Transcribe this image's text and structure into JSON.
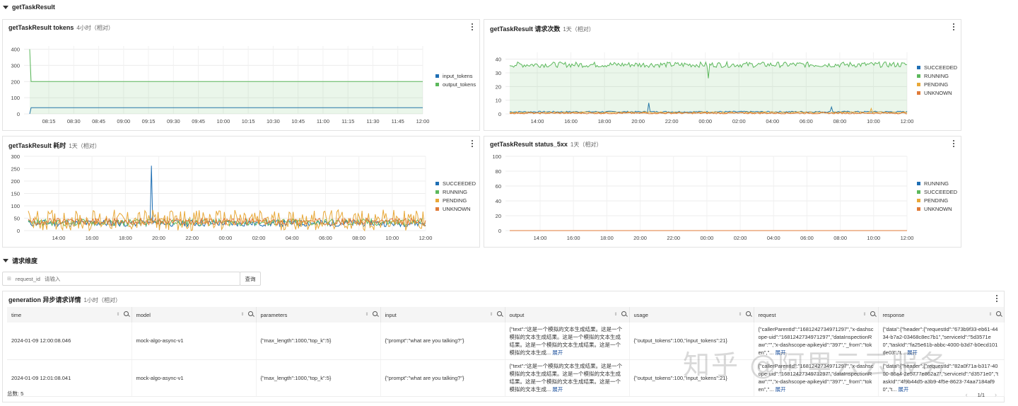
{
  "sections": {
    "top": "getTaskResult",
    "dimension": "请求维度"
  },
  "panels": {
    "tokens": {
      "title": "getTaskResult tokens",
      "sub": "4小时（相对）",
      "chart_data": {
        "type": "line",
        "yticks": [
          0,
          100,
          200,
          300,
          400
        ],
        "ylim": [
          0,
          420
        ],
        "xticks": [
          "08:15",
          "08:30",
          "08:45",
          "09:00",
          "09:15",
          "09:30",
          "09:45",
          "10:00",
          "10:15",
          "10:30",
          "10:45",
          "11:00",
          "11:15",
          "11:30",
          "11:45",
          "12:00"
        ],
        "series": [
          {
            "name": "input_tokens",
            "color": "#1f6fb4",
            "values": [
              0,
              38,
              38,
              38,
              38,
              38,
              38,
              38,
              38,
              38,
              38,
              38,
              38,
              38,
              38,
              38,
              38
            ]
          },
          {
            "name": "output_tokens",
            "color": "#5cb85c",
            "values": [
              400,
              200,
              200,
              200,
              200,
              200,
              200,
              200,
              200,
              200,
              200,
              200,
              200,
              200,
              200,
              200,
              200
            ]
          }
        ]
      }
    },
    "requests": {
      "title": "getTaskResult 请求次数",
      "sub": "1天（相对）",
      "chart_data": {
        "type": "line",
        "yticks": [
          0,
          10,
          20,
          30,
          40
        ],
        "ylim": [
          0,
          45
        ],
        "xticks": [
          "14:00",
          "16:00",
          "18:00",
          "20:00",
          "22:00",
          "00:00",
          "02:00",
          "04:00",
          "06:00",
          "08:00",
          "10:00",
          "12:00"
        ],
        "series": [
          {
            "name": "SUCCEEDED",
            "color": "#1f6fb4",
            "base": 1.5,
            "spikes": [
              [
                0.35,
                8
              ],
              [
                0.81,
                5
              ]
            ]
          },
          {
            "name": "RUNNING",
            "color": "#5cb85c",
            "base": 36,
            "spikes": [
              [
                0.5,
                26
              ]
            ]
          },
          {
            "name": "PENDING",
            "color": "#e8a838",
            "base": 1.0,
            "spikes": [
              [
                0.91,
                4
              ]
            ]
          },
          {
            "name": "UNKNOWN",
            "color": "#e07b39",
            "base": 0.5
          }
        ]
      }
    },
    "latency": {
      "title": "getTaskResult 耗时",
      "sub": "1天（相对）",
      "chart_data": {
        "type": "line",
        "yticks": [
          0,
          50,
          100,
          150,
          200,
          250,
          300
        ],
        "ylim": [
          0,
          300
        ],
        "xticks": [
          "14:00",
          "16:00",
          "18:00",
          "20:00",
          "22:00",
          "00:00",
          "02:00",
          "04:00",
          "06:00",
          "08:00",
          "10:00",
          "12:00"
        ],
        "series": [
          {
            "name": "SUCCEEDED",
            "color": "#1f6fb4",
            "base": 30,
            "spikes": [
              [
                0.31,
                262
              ]
            ]
          },
          {
            "name": "RUNNING",
            "color": "#5cb85c",
            "base": 33
          },
          {
            "name": "PENDING",
            "color": "#e8a838",
            "base": 42
          },
          {
            "name": "UNKNOWN",
            "color": "#e07b39",
            "base": 36
          }
        ]
      }
    },
    "status5xx": {
      "title": "getTaskResult status_5xx",
      "sub": "1天（相对）",
      "chart_data": {
        "type": "line",
        "yticks": [
          0,
          20,
          40,
          60,
          80,
          100
        ],
        "ylim": [
          0,
          100
        ],
        "xticks": [
          "14:00",
          "16:00",
          "18:00",
          "20:00",
          "22:00",
          "00:00",
          "02:00",
          "04:00",
          "06:00",
          "08:00",
          "10:00",
          "12:00"
        ],
        "series": [
          {
            "name": "RUNNING",
            "color": "#1f6fb4",
            "base": 0
          },
          {
            "name": "SUCCEEDED",
            "color": "#5cb85c",
            "base": 0
          },
          {
            "name": "PENDING",
            "color": "#e8a838",
            "base": 0
          },
          {
            "name": "UNKNOWN",
            "color": "#e07b39",
            "base": 0
          }
        ]
      }
    }
  },
  "search": {
    "label": "request_id",
    "placeholder": "请输入",
    "button": "查询"
  },
  "table": {
    "title": "generation 异步请求详情",
    "sub": "1小时（相对）",
    "columns": [
      "time",
      "model",
      "parameters",
      "input",
      "output",
      "usage",
      "request",
      "response"
    ],
    "rows": [
      {
        "time": "2024-01-09 12:00:08.046",
        "model": "mock-algo-async-v1",
        "parameters": "{\"max_length\":1000,\"top_k\":5}",
        "input": "{\"prompt\":\"what are you talking?\"}",
        "output": "{\"text\":\"这是一个模拟的文本生成结果。这是一个模拟的文本生成结果。这是一个模拟的文本生成结果。这是一个模拟的文本生成结果。这是一个模拟的文本生成...",
        "usage": "{\"output_tokens\":100,\"input_tokens\":21}",
        "request": "{\"callerParentId\":\"1681242734971297\",\"x-dashscope-uid\":\"1681242734971297\",\"dataInspectionRaw\":\"\",\"x-dashscope-apikeyid\":\"397\",\"_from\":\"token\",\"...",
        "response": "{\"data\":{\"header\":{\"requestId\":\"673b9f33-eb61-4434-b7a2-03468c8ec7b1\",\"serviceId\":\"5d3571e0\",\"taskId\":\"fa25e61b-abbc-4000-b3d7-b0ecd101de03\",\"t..."
      },
      {
        "time": "2024-01-09 12:01:08.041",
        "model": "mock-algo-async-v1",
        "parameters": "{\"max_length\":1000,\"top_k\":5}",
        "input": "{\"prompt\":\"what are you talking?\"}",
        "output": "{\"text\":\"这是一个模拟的文本生成结果。这是一个模拟的文本生成结果。这是一个模拟的文本生成结果。这是一个模拟的文本生成结果。这是一个模拟的文本生成...",
        "usage": "{\"output_tokens\":100,\"input_tokens\":21}",
        "request": "{\"callerParentId\":\"1681242734971297\",\"x-dashscope-uid\":\"1681242734971297\",\"dataInspectionRaw\":\"\",\"x-dashscope-apikeyid\":\"397\",\"_from\":\"token\",\"...",
        "response": "{\"data\":{\"header\":{\"requestId\":\"82a0f71a-b317-4000-86a4-2e5777e862a7\",\"serviceId\":\"d3571e0\",\"taskId\":\"4f9b44d5-a3b9-4f5e-8623-74aa7184af90\",\"t..."
      }
    ],
    "expand_label": "展开",
    "total": "总数:  5",
    "page": "1/1"
  },
  "watermark": "知乎 @阿里云云服务"
}
